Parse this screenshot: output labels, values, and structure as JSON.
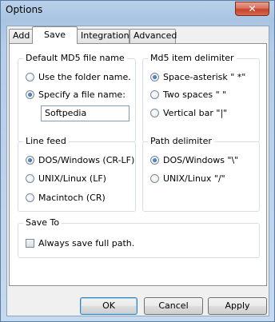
{
  "window": {
    "title": "Options",
    "close_glyph": "✕"
  },
  "tabs": [
    {
      "label": "Add"
    },
    {
      "label": "Save"
    },
    {
      "label": "Integration"
    },
    {
      "label": "Advanced"
    }
  ],
  "active_tab": "Save",
  "default_md5": {
    "title": "Default MD5 file name",
    "options": [
      "Use the folder name.",
      "Specify a file name:"
    ],
    "selected_index": 1,
    "file_name_value": "Softpedia"
  },
  "md5_delimiter": {
    "title": "Md5 item delimiter",
    "options": [
      "Space-asterisk \" *\"",
      "Two spaces \"  \"",
      "Vertical bar \"|\""
    ],
    "selected_index": 0
  },
  "line_feed": {
    "title": "Line feed",
    "options": [
      "DOS/Windows (CR-LF)",
      "UNIX/Linux (LF)",
      "Macintoch (CR)"
    ],
    "selected_index": 0
  },
  "path_delimiter": {
    "title": "Path delimiter",
    "options": [
      "DOS/Windows \"\\\"",
      "UNIX/Linux \"/\""
    ],
    "selected_index": 0
  },
  "save_to": {
    "title": "Save To",
    "always_full_path_label": "Always save full path.",
    "always_full_path_checked": false
  },
  "buttons": {
    "ok": "OK",
    "cancel": "Cancel",
    "apply": "Apply"
  }
}
